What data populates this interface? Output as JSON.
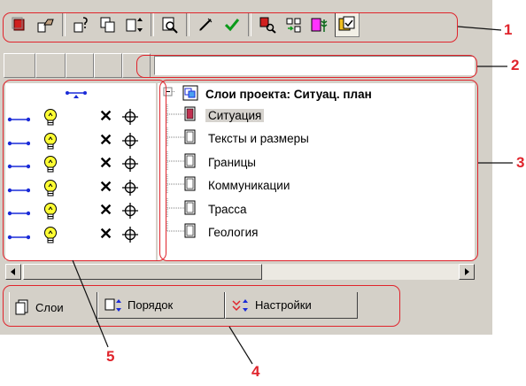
{
  "toolbar": {
    "buttons": [
      {
        "icon": "red-layer-icon"
      },
      {
        "icon": "hand-pointer-icon"
      },
      {
        "icon": "layer-properties-icon"
      },
      {
        "icon": "copy-layer-icon"
      },
      {
        "icon": "move-layer-icon"
      },
      {
        "icon": "zoom-layer-icon"
      },
      {
        "icon": "pen-icon"
      },
      {
        "icon": "checkmark-icon"
      },
      {
        "icon": "find-layer-icon"
      },
      {
        "icon": "merge-layers-icon"
      },
      {
        "icon": "layer-tree-icon"
      },
      {
        "icon": "current-layer-icon"
      }
    ]
  },
  "path_field": {
    "value": ""
  },
  "tree": {
    "root_label": "Слои проекта: Ситуац. план",
    "items": [
      {
        "label": "Ситуация",
        "selected": true
      },
      {
        "label": "Тексты и размеры",
        "selected": false
      },
      {
        "label": "Границы",
        "selected": false
      },
      {
        "label": "Коммуникации",
        "selected": false
      },
      {
        "label": "Трасса",
        "selected": false
      },
      {
        "label": "Геология",
        "selected": false
      }
    ]
  },
  "attributes": {
    "cross_glyph": "✕",
    "target_glyph": "⊕"
  },
  "tabs": [
    {
      "label": "Слои",
      "icon": "layers-tab-icon",
      "active": true
    },
    {
      "label": "Порядок",
      "icon": "order-tab-icon",
      "active": false
    },
    {
      "label": "Настройки",
      "icon": "settings-tab-icon",
      "active": false
    }
  ],
  "callouts": {
    "labels": [
      "1",
      "2",
      "3",
      "4",
      "5"
    ],
    "color": "#e0242c"
  },
  "colors": {
    "panel": "#d4d0c8",
    "link_blue": "#1a2bd8",
    "bulb_yellow": "#ffff33",
    "selection": "#d6d3ce"
  }
}
